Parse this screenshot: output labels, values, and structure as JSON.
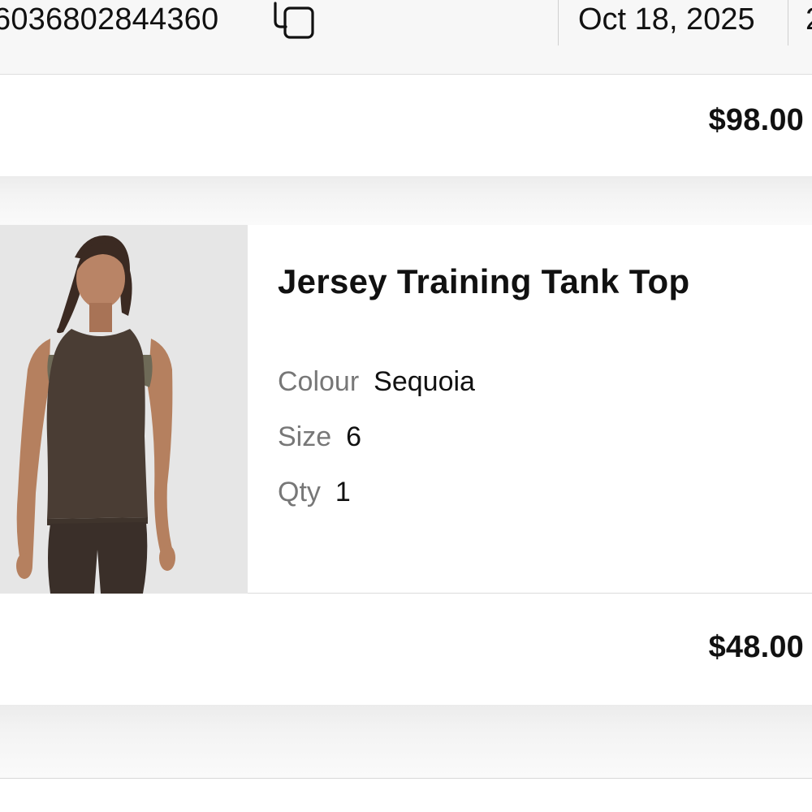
{
  "order": {
    "number": "6036802844360",
    "date": "Oct 18, 2025",
    "next_column_peek": "2"
  },
  "order_total": {
    "amount": "$98.00"
  },
  "item": {
    "title": "Jersey Training Tank Top",
    "attributes": [
      {
        "label": "Colour",
        "value": "Sequoia"
      },
      {
        "label": "Size",
        "value": "6"
      },
      {
        "label": "Qty",
        "value": "1"
      }
    ],
    "price": "$48.00"
  },
  "icons": {
    "copy": "copy-icon"
  },
  "colors": {
    "text_primary": "#111111",
    "text_secondary": "#777777",
    "header_bg": "#f7f7f7",
    "separator_bg": "#ececec"
  }
}
